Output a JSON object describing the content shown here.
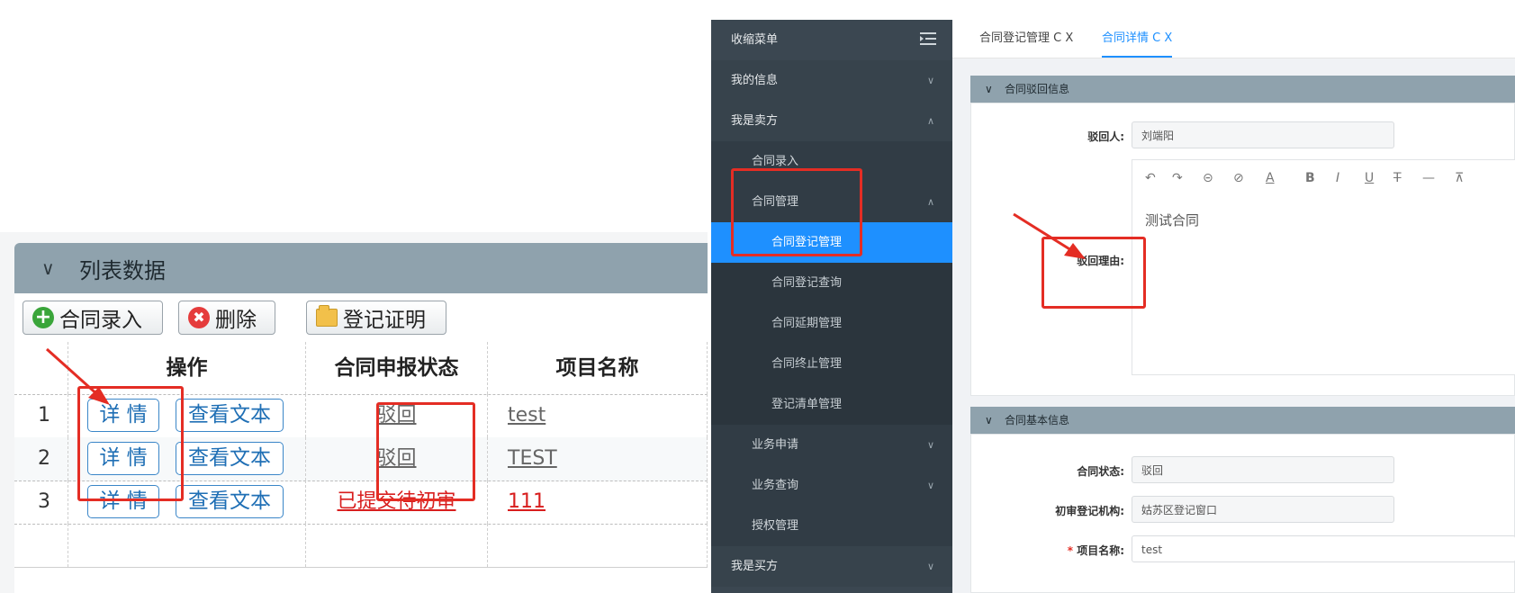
{
  "left": {
    "panel_title": "列表数据",
    "toolbar": {
      "add_label": "合同录入",
      "delete_label": "删除",
      "cert_label": "登记证明"
    },
    "columns": [
      "操作",
      "合同申报状态",
      "项目名称"
    ],
    "rows": [
      {
        "num": "1",
        "detail": "详 情",
        "view": "查看文本",
        "status": "驳回",
        "project": "test"
      },
      {
        "num": "2",
        "detail": "详 情",
        "view": "查看文本",
        "status": "驳回",
        "project": "TEST"
      },
      {
        "num": "3",
        "detail": "详 情",
        "view": "查看文本",
        "status": "已提交待初审",
        "project": "111"
      }
    ]
  },
  "sidebar": {
    "collapse_label": "收缩菜单",
    "items": [
      {
        "label": "我的信息"
      },
      {
        "label": "我是卖方"
      },
      {
        "label": "合同录入"
      },
      {
        "label": "合同管理"
      },
      {
        "label": "合同登记管理"
      },
      {
        "label": "合同登记查询"
      },
      {
        "label": "合同延期管理"
      },
      {
        "label": "合同终止管理"
      },
      {
        "label": "登记清单管理"
      },
      {
        "label": "业务申请"
      },
      {
        "label": "业务查询"
      },
      {
        "label": "授权管理"
      },
      {
        "label": "我是买方"
      }
    ]
  },
  "tabs": {
    "tab1": "合同登记管理",
    "tab2": "合同详情",
    "refresh_glyph": "C",
    "close_glyph": "X"
  },
  "reject_card": {
    "title": "合同驳回信息",
    "rejecter_label": "驳回人:",
    "rejecter_value": "刘端阳",
    "reason_label": "驳回理由:",
    "reason_text": "测试合同"
  },
  "basic_card": {
    "title": "合同基本信息",
    "status_label": "合同状态:",
    "status_value": "驳回",
    "org_label": "初审登记机构:",
    "org_value": "姑苏区登记窗口",
    "project_label": "项目名称:",
    "project_value": "test"
  },
  "colors": {
    "accent": "#1e90ff",
    "annotation": "#e42d24",
    "sidebar_bg": "#3b4751",
    "header_bg": "#8fa2ad"
  }
}
